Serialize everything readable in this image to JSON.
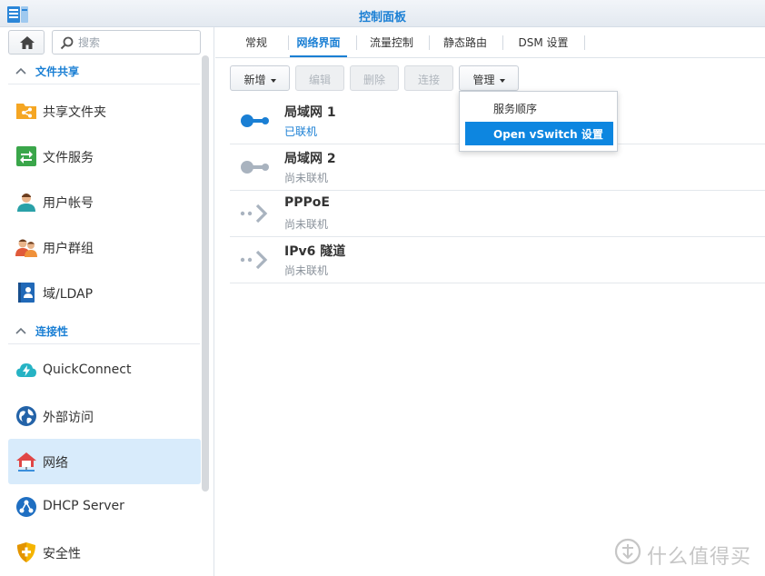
{
  "window": {
    "title": "控制面板",
    "app_icon": "control-panel-icon"
  },
  "sidebar": {
    "home_icon": "home-icon",
    "search_placeholder": "搜索",
    "sections": [
      {
        "label": "文件共享",
        "items": [
          {
            "label": "共享文件夹",
            "icon": "shared-folder-icon"
          },
          {
            "label": "文件服务",
            "icon": "file-services-icon"
          },
          {
            "label": "用户帐号",
            "icon": "user-icon"
          },
          {
            "label": "用户群组",
            "icon": "group-icon"
          },
          {
            "label": "域/LDAP",
            "icon": "ldap-icon"
          }
        ]
      },
      {
        "label": "连接性",
        "items": [
          {
            "label": "QuickConnect",
            "icon": "quickconnect-icon"
          },
          {
            "label": "外部访问",
            "icon": "external-access-icon"
          },
          {
            "label": "网络",
            "icon": "network-icon",
            "active": true
          },
          {
            "label": "DHCP Server",
            "icon": "dhcp-server-icon"
          },
          {
            "label": "安全性",
            "icon": "security-icon"
          }
        ]
      }
    ]
  },
  "tabs": [
    "常规",
    "网络界面",
    "流量控制",
    "静态路由",
    "DSM 设置"
  ],
  "active_tab": "网络界面",
  "toolbar": {
    "create": "新增",
    "edit": "编辑",
    "delete": "删除",
    "connect": "连接",
    "manage": "管理"
  },
  "interfaces": [
    {
      "name": "局域网 1",
      "status": "已联机",
      "icon": "lan-connected-icon"
    },
    {
      "name": "局域网 2",
      "status": "尚未联机",
      "icon": "lan-disconnected-icon"
    },
    {
      "name": "PPPoE",
      "status": "尚未联机",
      "icon": "pppoe-icon"
    },
    {
      "name": "IPv6 隧道",
      "status": "尚未联机",
      "icon": "ipv6-tunnel-icon"
    }
  ],
  "manage_menu": {
    "items": [
      "服务顺序",
      "Open vSwitch 设置"
    ],
    "highlighted": "Open vSwitch 设置"
  },
  "watermark": "什么值得买",
  "colors": {
    "accent": "#1a7fd4",
    "menu_highlight": "#0d86e0",
    "active_nav_bg": "#d8ebfb"
  }
}
